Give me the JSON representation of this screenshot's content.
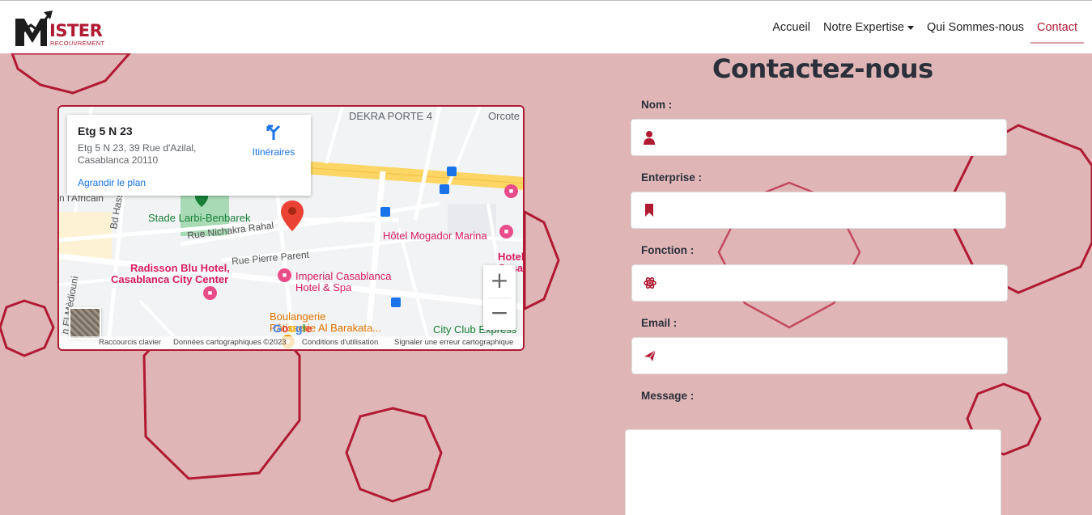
{
  "brand": {
    "logo_word": "ISTER",
    "logo_sub": "RECOUVREMENT",
    "brand_color": "#b01a33"
  },
  "nav": {
    "items": [
      {
        "label": "Accueil"
      },
      {
        "label": "Notre Expertise"
      },
      {
        "label": "Qui Sommes-nous"
      },
      {
        "label": "Contact"
      }
    ]
  },
  "map": {
    "card": {
      "title": "Etg 5 N 23",
      "address": "Etg 5 N 23, 39 Rue d'Azilal, Casablanca 20110",
      "enlarge": "Agrandir le plan",
      "directions": "Itinéraires"
    },
    "labels": {
      "dekra": "DEKRA PORTE 4",
      "orcote": "Orcote",
      "stade": "Stade Larbi-Benbarek",
      "nichakra": "Rue Nichakra Rahal",
      "mogador": "Hôtel Mogador Marina",
      "radisson1": "Radisson Blu Hotel,",
      "radisson2": "Casablanca City Center",
      "pierre": "Rue Pierre Parent",
      "imperial1": "Imperial Casablanca",
      "imperial2": "Hotel & Spa",
      "boulangerie1": "Boulangerie",
      "boulangerie2": "Pâtisserie Al Barakata...",
      "cityclub": "City Club Express",
      "hassan": "Bd Hassan",
      "africain": "n l'Africain",
      "medouni": "n El Mèdiouni",
      "hotel_edge": "Hotel",
      "casa_edge": "Casa"
    },
    "google": "Google",
    "attribution": {
      "shortcuts": "Raccourcis clavier",
      "data": "Données cartographiques ©2023",
      "terms": "Conditions d'utilisation",
      "report": "Signaler une erreur cartographique"
    },
    "zoom_in": "+",
    "zoom_out": "−"
  },
  "form": {
    "title": "Contactez-nous",
    "fields": [
      {
        "label": "Nom :",
        "icon": "user-icon",
        "placeholder": ""
      },
      {
        "label": "Enterprise :",
        "icon": "bookmark-icon",
        "placeholder": ""
      },
      {
        "label": "Fonction :",
        "icon": "atom-icon",
        "placeholder": ""
      },
      {
        "label": "Email :",
        "icon": "paper-plane-icon",
        "placeholder": ""
      }
    ],
    "message_label": "Message :",
    "message_placeholder": ""
  }
}
